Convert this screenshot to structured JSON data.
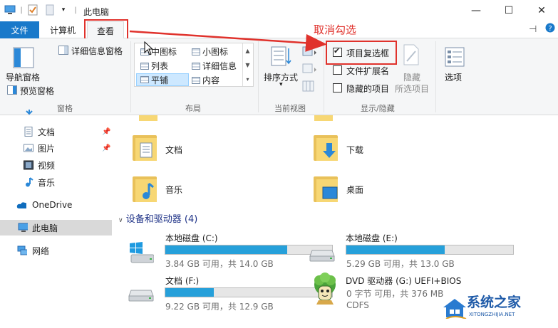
{
  "window": {
    "title": "此电脑"
  },
  "tabs": {
    "file": "文件",
    "computer": "计算机",
    "view": "查看"
  },
  "ribbon": {
    "pane": {
      "nav_pane": "导航窗格",
      "preview_pane": "预览窗格",
      "details_pane": "详细信息窗格",
      "group": "窗格"
    },
    "layout": {
      "items": [
        "中图标",
        "小图标",
        "列表",
        "详细信息",
        "平铺",
        "内容"
      ],
      "selected": "平铺",
      "group": "布局"
    },
    "current_view": {
      "sort": "排序方式",
      "group": "当前视图"
    },
    "show_hide": {
      "item_checkboxes": {
        "label": "项目复选框",
        "checked": true
      },
      "file_extensions": {
        "label": "文件扩展名",
        "checked": false
      },
      "hidden_items": {
        "label": "隐藏的项目",
        "checked": false
      },
      "hide_selected_1": "隐藏",
      "hide_selected_2": "所选项目",
      "group": "显示/隐藏"
    },
    "options": "选项"
  },
  "annotation": "取消勾选",
  "nav": {
    "items": [
      {
        "label": "文档",
        "pinned": true
      },
      {
        "label": "图片",
        "pinned": true
      },
      {
        "label": "视频",
        "pinned": false
      },
      {
        "label": "音乐",
        "pinned": false
      },
      {
        "label": "OneDrive",
        "pinned": false
      },
      {
        "label": "此电脑",
        "pinned": false
      },
      {
        "label": "网络",
        "pinned": false
      }
    ],
    "selected": "此电脑"
  },
  "folders": [
    "文档",
    "下载",
    "音乐",
    "桌面"
  ],
  "devices": {
    "header": "设备和驱动器 (4)",
    "drives": [
      {
        "name": "本地磁盘 (C:)",
        "usage": "3.84 GB 可用，共 14.0 GB",
        "used_fraction": 0.73
      },
      {
        "name": "本地磁盘 (E:)",
        "usage": "5.29 GB 可用，共 13.0 GB",
        "used_fraction": 0.59
      },
      {
        "name": "文档 (F:)",
        "usage": "9.22 GB 可用，共 12.9 GB",
        "used_fraction": 0.29
      },
      {
        "name": "DVD 驱动器 (G:) UEFI+BIOS",
        "usage": "0 字节 可用，共 376 MB",
        "fs": "CDFS"
      }
    ]
  },
  "watermark": {
    "brand": "系统之家",
    "url": "XITONGZHIJIA.NET"
  }
}
